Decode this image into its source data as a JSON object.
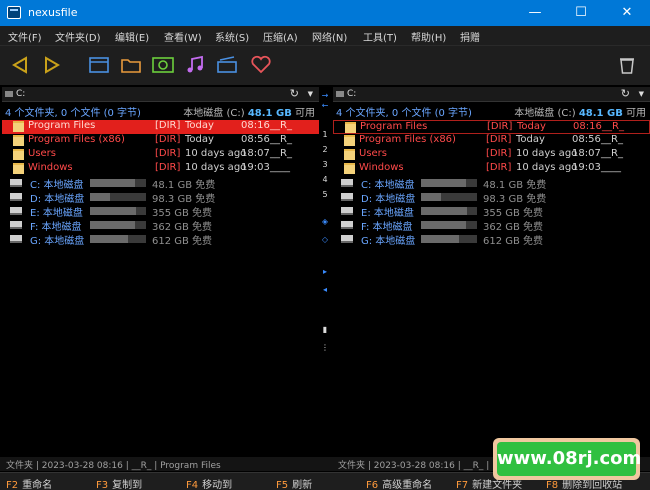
{
  "window": {
    "title": "nexusfile",
    "minimize": "—",
    "maximize": "☐",
    "close": "✕"
  },
  "menu": [
    "文件(F)",
    "文件夹(D)",
    "编辑(E)",
    "查看(W)",
    "系统(S)",
    "压缩(A)",
    "网络(N)",
    "工具(T)",
    "帮助(H)",
    "捐赠"
  ],
  "left": {
    "drive": "C:",
    "summary": "4 个文件夹, 0 个文件 (0 字节)",
    "disk_label": "本地磁盘 (C:)",
    "disk_free": "48.1 GB",
    "disk_suffix": "可用",
    "folders": [
      {
        "name": "Program Files",
        "tag": "[DIR]",
        "date": "Today",
        "time": "08:16",
        "attr": "__R_"
      },
      {
        "name": "Program Files (x86)",
        "tag": "[DIR]",
        "date": "Today",
        "time": "08:56",
        "attr": "__R_"
      },
      {
        "name": "Users",
        "tag": "[DIR]",
        "date": "10 days ago",
        "time": "18:07",
        "attr": "__R_"
      },
      {
        "name": "Windows",
        "tag": "[DIR]",
        "date": "10 days ago",
        "time": "19:03",
        "attr": "____"
      }
    ],
    "drives": [
      {
        "name": "C: 本地磁盘",
        "size": "48.1 GB 免费",
        "usage": 0.8
      },
      {
        "name": "D: 本地磁盘",
        "size": "98.3 GB 免费",
        "usage": 0.35
      },
      {
        "name": "E: 本地磁盘",
        "size": "355 GB 免费",
        "usage": 0.82
      },
      {
        "name": "F: 本地磁盘",
        "size": "362 GB 免费",
        "usage": 0.8
      },
      {
        "name": "G: 本地磁盘",
        "size": "612 GB 免费",
        "usage": 0.68
      }
    ],
    "status": "文件夹  |  2023-03-28 08:16  |  __R_  |  Program Files"
  },
  "right": {
    "drive": "C:",
    "summary": "4 个文件夹, 0 个文件 (0 字节)",
    "disk_label": "本地磁盘 (C:)",
    "disk_free": "48.1 GB",
    "disk_suffix": "可用",
    "folders": [
      {
        "name": "Program Files",
        "tag": "[DIR]",
        "date": "Today",
        "time": "08:16",
        "attr": "__R_"
      },
      {
        "name": "Program Files (x86)",
        "tag": "[DIR]",
        "date": "Today",
        "time": "08:56",
        "attr": "__R_"
      },
      {
        "name": "Users",
        "tag": "[DIR]",
        "date": "10 days ago",
        "time": "18:07",
        "attr": "__R_"
      },
      {
        "name": "Windows",
        "tag": "[DIR]",
        "date": "10 days ago",
        "time": "19:03",
        "attr": "____"
      }
    ],
    "drives": [
      {
        "name": "C: 本地磁盘",
        "size": "48.1 GB 免费",
        "usage": 0.8
      },
      {
        "name": "D: 本地磁盘",
        "size": "98.3 GB 免费",
        "usage": 0.35
      },
      {
        "name": "E: 本地磁盘",
        "size": "355 GB 免费",
        "usage": 0.82
      },
      {
        "name": "F: 本地磁盘",
        "size": "362 GB 免费",
        "usage": 0.8
      },
      {
        "name": "G: 本地磁盘",
        "size": "612 GB 免费",
        "usage": 0.68
      }
    ],
    "status": "文件夹  |  2023-03-28 08:16  |  __R_  |  Program Files"
  },
  "middle": [
    "1",
    "2",
    "3",
    "4",
    "5"
  ],
  "fkeys": [
    {
      "key": "F2",
      "label": "重命名"
    },
    {
      "key": "F3",
      "label": "复制到"
    },
    {
      "key": "F4",
      "label": "移动到"
    },
    {
      "key": "F5",
      "label": "刷新"
    },
    {
      "key": "F6",
      "label": "高级重命名"
    },
    {
      "key": "F7",
      "label": "新建文件夹"
    },
    {
      "key": "F8",
      "label": "删除到回收站"
    }
  ],
  "watermark": "www.08rj.com",
  "colors": {
    "titlebar": "#0078d7",
    "selection": "#e2201c",
    "accent": "#58b8ff",
    "fkey": "#ff9a3c"
  }
}
